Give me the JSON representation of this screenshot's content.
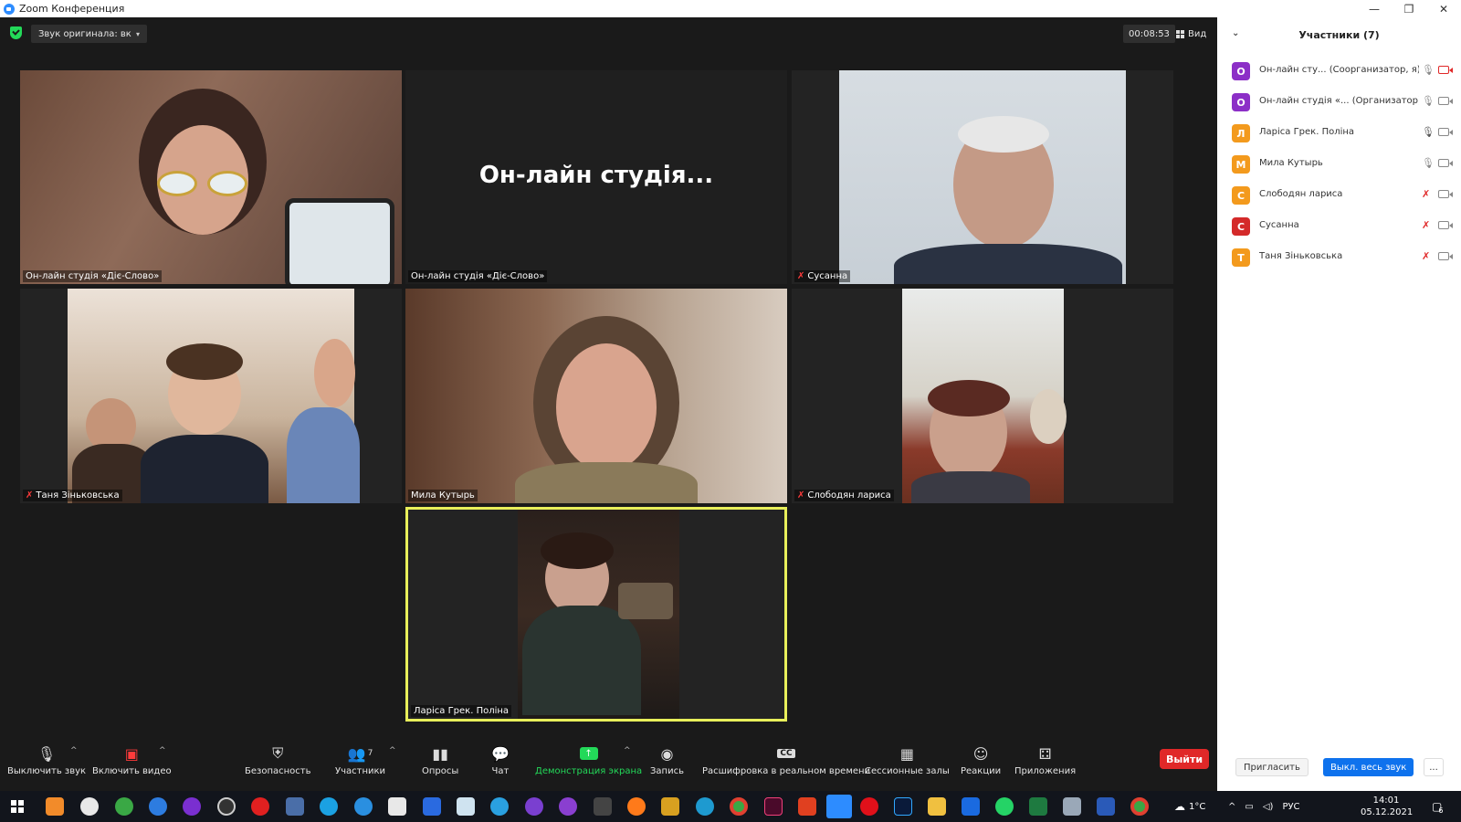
{
  "window": {
    "title": "Zoom Конференция",
    "min": "—",
    "restore": "❐",
    "close": "✕"
  },
  "topbar": {
    "original_sound": "Звук оригинала: вкл.",
    "dropdown": "▾",
    "timer": "00:08:53",
    "view": "Вид"
  },
  "tiles": [
    {
      "name": "Он-лайн студія «Діє-Слово»",
      "muted": false
    },
    {
      "name": "Он-лайн студія «Діє-Слово»",
      "display": "Он-лайн  студія...",
      "muted": false
    },
    {
      "name": "Сусанна",
      "muted": true
    },
    {
      "name": "Таня Зіньковська",
      "muted": true
    },
    {
      "name": "Мила Кутырь",
      "muted": false
    },
    {
      "name": "Слободян лариса",
      "muted": true
    },
    {
      "name": "Ларіса Грек. Поліна",
      "muted": false,
      "active_speaker": true
    }
  ],
  "toolbar": {
    "mute": "Выключить звук",
    "video": "Включить видео",
    "security": "Безопасность",
    "participants": "Участники",
    "participants_count": "7",
    "polls": "Опросы",
    "chat": "Чат",
    "share": "Демонстрация экрана",
    "record": "Запись",
    "captions": "Расшифровка в реальном времени",
    "breakout": "Сессионные залы",
    "reactions": "Реакции",
    "apps": "Приложения",
    "leave": "Выйти",
    "cc": "CC"
  },
  "panel": {
    "title": "Участники (7)",
    "participants": [
      {
        "initial": "О",
        "name": "Он-лайн сту...  (Соорганизатор, я)",
        "color": "#8c2fc7",
        "mic_off": false,
        "cam_off": true
      },
      {
        "initial": "О",
        "name": "Он-лайн студія «...  (Организатор)",
        "color": "#8c2fc7",
        "mic_off": false,
        "cam_off": false
      },
      {
        "initial": "Л",
        "name": "Ларіса Грек. Поліна",
        "color": "#f39a1d",
        "mic_off": false,
        "cam_off": false
      },
      {
        "initial": "М",
        "name": "Мила Кутырь",
        "color": "#f39a1d",
        "mic_off": false,
        "cam_off": false
      },
      {
        "initial": "С",
        "name": "Слободян лариса",
        "color": "#f39a1d",
        "mic_off": true,
        "cam_off": false
      },
      {
        "initial": "С",
        "name": "Сусанна",
        "color": "#d42a2a",
        "mic_off": true,
        "cam_off": false
      },
      {
        "initial": "Т",
        "name": "Таня Зіньковська",
        "color": "#f39a1d",
        "mic_off": true,
        "cam_off": false
      }
    ],
    "invite": "Пригласить",
    "mute_all": "Выкл. весь звук",
    "more": "..."
  },
  "taskbar": {
    "temperature": "1°C",
    "lang": "РУС",
    "time": "14:01",
    "date": "05.12.2021",
    "notifications": "6"
  }
}
